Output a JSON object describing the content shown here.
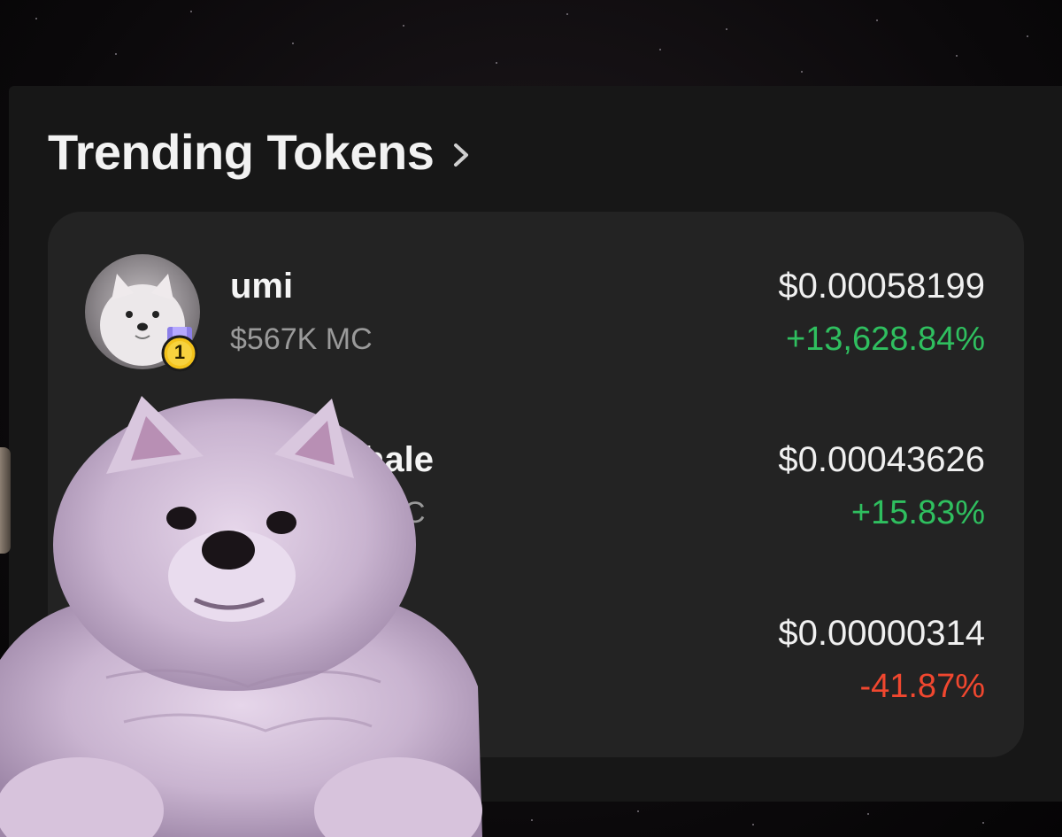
{
  "section": {
    "title": "Trending Tokens",
    "chevron_icon": "chevron-right-icon"
  },
  "tokens": [
    {
      "name": "umi",
      "market_cap": "$567K MC",
      "rank": "1",
      "price": "$0.00058199",
      "change": "+13,628.84%",
      "trend": "up"
    },
    {
      "name": "hale",
      "market_cap": "C",
      "price": "$0.00043626",
      "change": "+15.83%",
      "trend": "up"
    },
    {
      "price": "$0.00000314",
      "change": "-41.87%",
      "trend": "down"
    }
  ],
  "colors": {
    "panel_bg": "#171717",
    "card_bg": "#232323",
    "positive": "#2fbf5f",
    "negative": "#f0472f",
    "badge_gold": "#f3c21b"
  }
}
